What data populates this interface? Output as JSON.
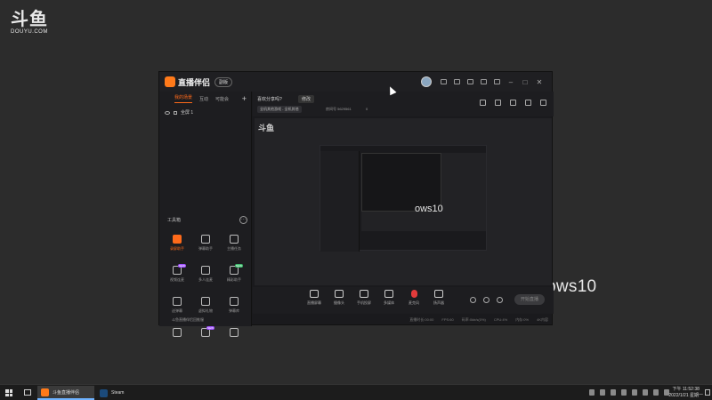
{
  "desktop": {
    "logo_glyphs": "斗鱼",
    "logo_sub": "DOUYU.COM",
    "background_text": "ows10"
  },
  "app": {
    "title": "直播伴侣",
    "version_label": "副版",
    "titlebar_icons": [
      "avatar",
      "mail-icon",
      "crown-icon",
      "image-icon",
      "trophy-icon",
      "menu-icon"
    ],
    "sidebar": {
      "tabs": [
        "我的场景",
        "互动",
        "可能会"
      ],
      "add": "+",
      "scene_name": "全屏 1",
      "toolbox_title": "工具箱",
      "tools": [
        {
          "label": "录屏助手",
          "active": true
        },
        {
          "label": "弹幕助手",
          "active": false
        },
        {
          "label": "主播任务",
          "active": false
        },
        {
          "label": "视频连麦",
          "active": false,
          "badge": "NEW"
        },
        {
          "label": "多人连麦",
          "active": false
        },
        {
          "label": "精彩助手",
          "active": false,
          "badge": "NEW"
        },
        {
          "label": "送弹幕",
          "active": false
        },
        {
          "label": "虚拟礼物",
          "active": false
        },
        {
          "label": "弹幕库",
          "active": false
        },
        {
          "label": "",
          "active": false
        },
        {
          "label": "",
          "active": false,
          "badge": "NEW"
        },
        {
          "label": "",
          "active": false
        }
      ],
      "bottom_hint": "斗鱼直播伴侣回推服"
    },
    "stream_head": {
      "title": "喜欢分享吗?",
      "edit_label": "修改",
      "category": "全机其他游戏 - 全机其他",
      "room_no": "房间号 5629561",
      "hot": "0"
    },
    "preview": {
      "watermark": "斗鱼",
      "nested_text": "ows10"
    },
    "stream_bar": {
      "tools": [
        "直播屏幕",
        "摄像头",
        "手机投屏",
        "多媒体",
        "麦克风",
        "扬声器"
      ],
      "start_button": "开始直播"
    },
    "statusbar": {
      "stats": [
        "直播时长:00:00",
        "FPS:60",
        "码率:0kb/s(0%)",
        "CPU:4%",
        "内存:0%",
        "4K内容"
      ]
    }
  },
  "taskbar": {
    "items": [
      {
        "label": "斗鱼直播伴侣",
        "active": true,
        "color": "#ff7a1a"
      },
      {
        "label": "Steam",
        "active": false,
        "color": "#1b4a7a"
      }
    ],
    "clock_time": "下午 11:52:38",
    "clock_date": "2022/1/21 星期一"
  },
  "colors": {
    "accent": "#ff6a1a",
    "mic": "#e23b3b"
  }
}
